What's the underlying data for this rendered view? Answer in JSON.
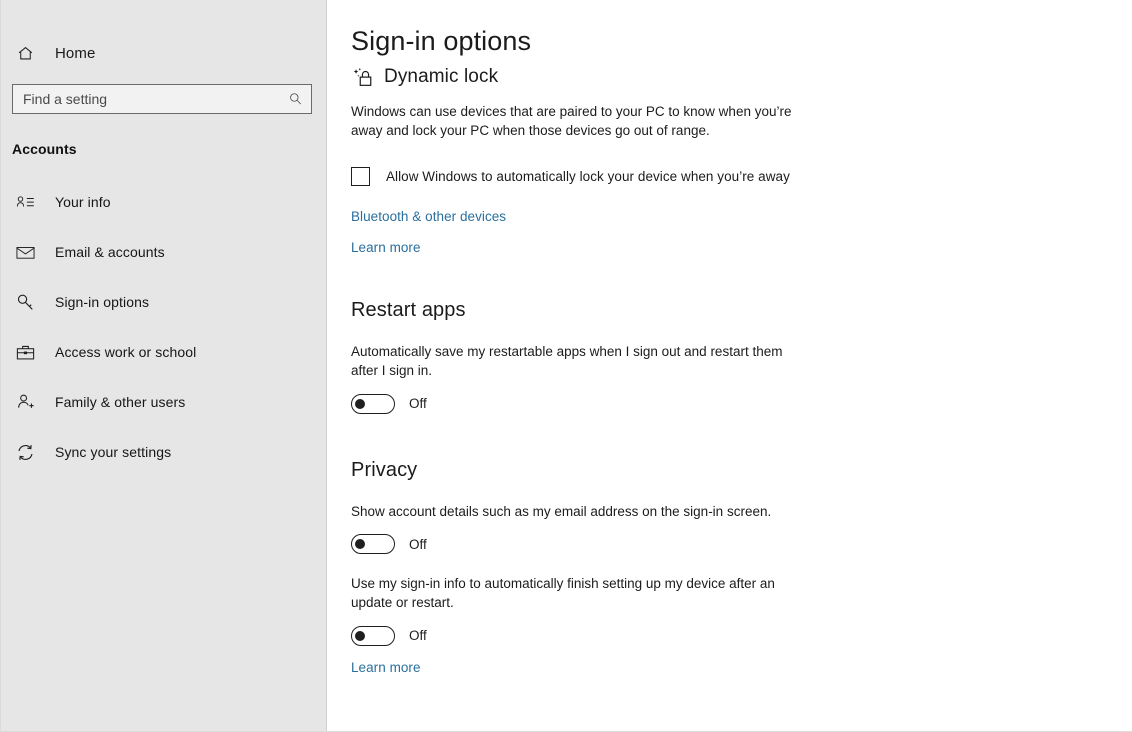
{
  "sidebar": {
    "home": {
      "label": "Home",
      "icon": "home-icon"
    },
    "search": {
      "placeholder": "Find a setting",
      "value": "",
      "icon": "search-icon"
    },
    "category": "Accounts",
    "items": [
      {
        "label": "Your info",
        "icon": "person-list-icon"
      },
      {
        "label": "Email & accounts",
        "icon": "envelope-icon"
      },
      {
        "label": "Sign-in options",
        "icon": "key-icon"
      },
      {
        "label": "Access work or school",
        "icon": "briefcase-icon"
      },
      {
        "label": "Family & other users",
        "icon": "person-add-icon"
      },
      {
        "label": "Sync your settings",
        "icon": "sync-icon"
      }
    ]
  },
  "content": {
    "page_title": "Sign-in options",
    "dynamic_lock": {
      "heading": "Dynamic lock",
      "icon": "dynamic-lock-icon",
      "description": "Windows can use devices that are paired to your PC to know when you’re away and lock your PC when those devices go out of range.",
      "checkbox_label": "Allow Windows to automatically lock your device when you’re away",
      "checkbox_checked": false,
      "link_bluetooth": "Bluetooth & other devices",
      "link_learn_more": "Learn more"
    },
    "restart_apps": {
      "heading": "Restart apps",
      "description": "Automatically save my restartable apps when I sign out and restart them after I sign in.",
      "toggle_state": "Off",
      "toggle_on": false
    },
    "privacy": {
      "heading": "Privacy",
      "setting_one": {
        "description": "Show account details such as my email address on the sign-in screen.",
        "toggle_state": "Off",
        "toggle_on": false
      },
      "setting_two": {
        "description": "Use my sign-in info to automatically finish setting up my device after an update or restart.",
        "toggle_state": "Off",
        "toggle_on": false
      },
      "link_learn_more": "Learn more"
    }
  },
  "colors": {
    "link": "#2a6f9e",
    "sidebar_bg": "#e6e6e6",
    "content_bg": "#ffffff",
    "text": "#1c1c1c"
  }
}
